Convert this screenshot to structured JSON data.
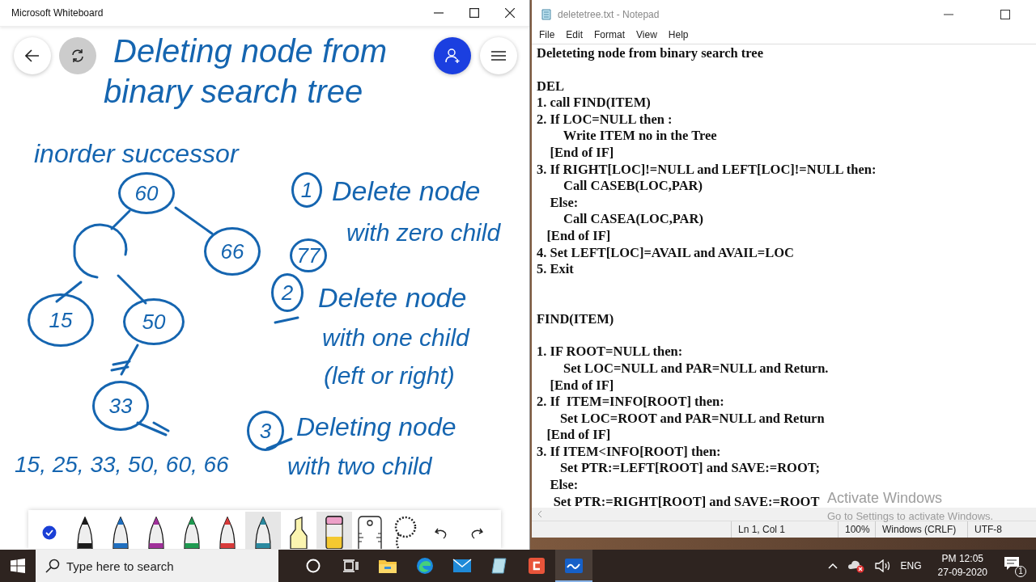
{
  "whiteboard": {
    "title": "Microsoft Whiteboard",
    "ink": [
      {
        "text": "Deleting node from"
      },
      {
        "text": "binary search tree"
      },
      {
        "text": "inorder successor"
      },
      {
        "text": "Delete node"
      },
      {
        "text": "with zero child"
      },
      {
        "text": "Delete node"
      },
      {
        "text": "with one child"
      },
      {
        "text": "(left or right)"
      },
      {
        "text": "Deleting node"
      },
      {
        "text": "with two child"
      },
      {
        "text": "15, 25, 33, 50, 60, 66"
      }
    ],
    "steps": [
      "1",
      "2",
      "3"
    ],
    "nodes": [
      "60",
      "66",
      "77",
      "15",
      "50",
      "33"
    ],
    "tools": [
      {
        "kind": "select",
        "selected": false
      },
      {
        "kind": "pen",
        "color": "#1a1a1a",
        "selected": false
      },
      {
        "kind": "pen",
        "color": "#1f6fc0",
        "selected": false
      },
      {
        "kind": "pen",
        "color": "#a0309a",
        "selected": false
      },
      {
        "kind": "pen",
        "color": "#1e9a50",
        "selected": false
      },
      {
        "kind": "pen",
        "color": "#d83a3a",
        "selected": false
      },
      {
        "kind": "pen",
        "color": "#2a8aa0",
        "selected": true
      },
      {
        "kind": "highlighter",
        "selected": false
      },
      {
        "kind": "eraser",
        "selected": true
      },
      {
        "kind": "ruler",
        "selected": false
      },
      {
        "kind": "lasso",
        "selected": false
      },
      {
        "kind": "undo",
        "selected": false
      },
      {
        "kind": "redo",
        "selected": false
      }
    ]
  },
  "notepad": {
    "title": "deletetree.txt - Notepad",
    "menu": [
      "File",
      "Edit",
      "Format",
      "View",
      "Help"
    ],
    "blocks": [
      [
        "Deleteting node from binary search tree"
      ],
      [
        "DEL",
        "1. call FIND(ITEM)",
        "2. If LOC=NULL then :",
        "        Write ITEM no in the Tree",
        "    [End of IF]",
        "3. If RIGHT[LOC]!=NULL and LEFT[LOC]!=NULL then:",
        "        Call CASEB(LOC,PAR)",
        "    Else:",
        "        Call CASEA(LOC,PAR)",
        "   [End of IF]",
        "4. Set LEFT[LOC]=AVAIL and AVAIL=LOC",
        "5. Exit"
      ],
      [
        "FIND(ITEM)"
      ],
      [
        "1. IF ROOT=NULL then:",
        "        Set LOC=NULL and PAR=NULL and Return.",
        "    [End of IF]",
        "2. If  ITEM=INFO[ROOT] then:",
        "       Set LOC=ROOT and PAR=NULL and Return",
        "   [End of IF]",
        "3. If ITEM<INFO[ROOT] then:",
        "       Set PTR:=LEFT[ROOT] and SAVE:=ROOT;",
        "    Else:",
        "     Set PTR:=RIGHT[ROOT] and SAVE:=ROOT"
      ]
    ],
    "status": [
      "Ln 1, Col 1",
      "100%",
      "Windows (CRLF)",
      "UTF-8"
    ]
  },
  "activation": {
    "title": "Activate Windows",
    "text": "Go to Settings to activate Windows."
  },
  "taskbar": {
    "search_placeholder": "Type here to search",
    "language": "ENG",
    "time": "PM 12:05",
    "date": "27-09-2020",
    "notifications": "1"
  }
}
